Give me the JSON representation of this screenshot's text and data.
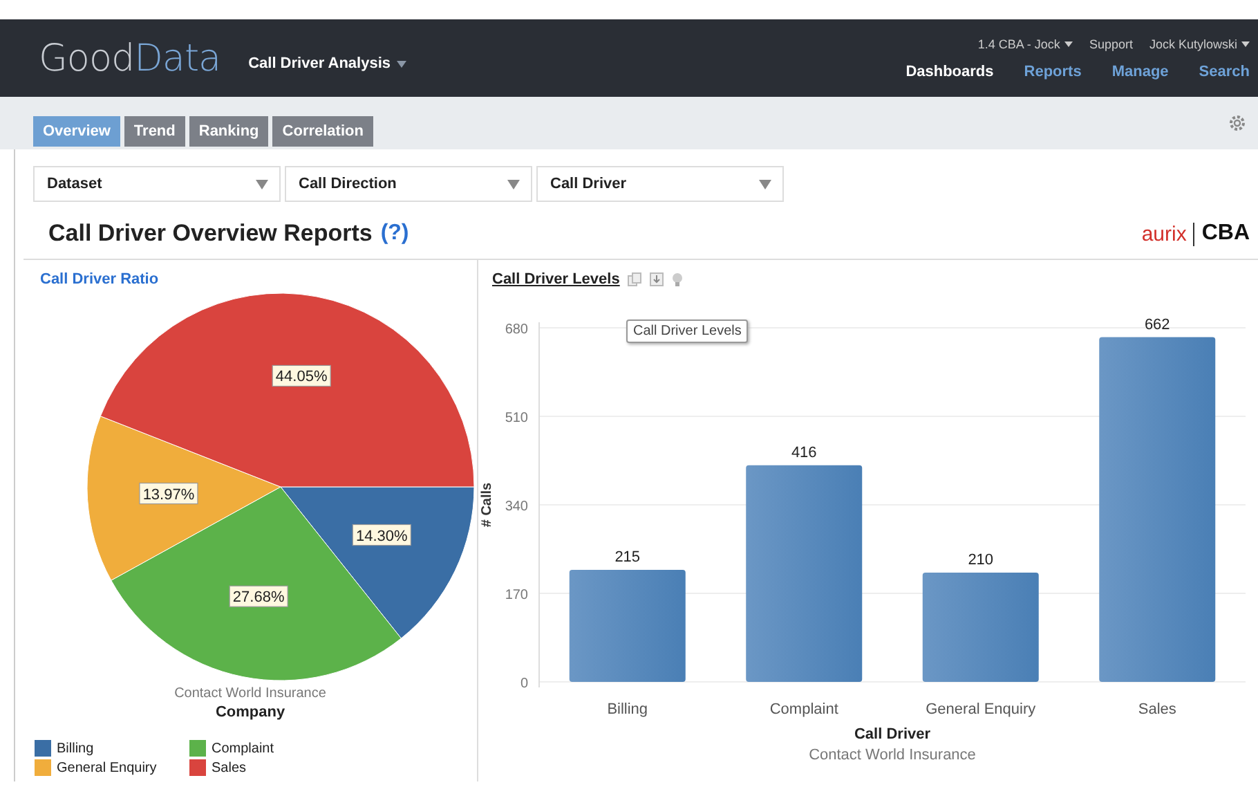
{
  "header": {
    "logo_parts": [
      "Good",
      "Data"
    ],
    "project": "Call Driver Analysis",
    "top_links": [
      {
        "label": "1.4 CBA - Jock",
        "dropdown": true
      },
      {
        "label": "Support",
        "dropdown": false
      },
      {
        "label": "Jock Kutylowski",
        "dropdown": true
      }
    ],
    "nav": [
      {
        "label": "Dashboards",
        "selected": true
      },
      {
        "label": "Reports",
        "selected": false
      },
      {
        "label": "Manage",
        "selected": false
      },
      {
        "label": "Search",
        "selected": false
      }
    ]
  },
  "tabs": [
    {
      "label": "Overview",
      "selected": true
    },
    {
      "label": "Trend",
      "selected": false
    },
    {
      "label": "Ranking",
      "selected": false
    },
    {
      "label": "Correlation",
      "selected": false
    }
  ],
  "filters": [
    {
      "label": "Dataset"
    },
    {
      "label": "Call Direction"
    },
    {
      "label": "Call Driver"
    }
  ],
  "page_title": "Call Driver Overview Reports",
  "help": "(?)",
  "brand": [
    "aurix",
    "CBA"
  ],
  "ratio_report": {
    "title": "Call Driver Ratio",
    "caption": "Contact World Insurance",
    "caption_bold": "Company",
    "chart_data": {
      "type": "pie",
      "categories": [
        "Billing",
        "Complaint",
        "General Enquiry",
        "Sales"
      ],
      "series": [
        {
          "values": [
            14.3,
            27.68,
            13.97,
            44.05
          ]
        }
      ],
      "colors": [
        "#3a6ea5",
        "#5cb24a",
        "#f0ad3c",
        "#d9443e"
      ],
      "value_labels": [
        "14.30%",
        "27.68%",
        "13.97%",
        "44.05%"
      ]
    }
  },
  "levels_report": {
    "title": "Call Driver Levels",
    "tooltip": "Call Driver Levels",
    "subtitle": "Contact World Insurance",
    "chart_data": {
      "type": "bar",
      "xlabel": "Call Driver",
      "ylabel": "# Calls",
      "categories": [
        "Billing",
        "Complaint",
        "General Enquiry",
        "Sales"
      ],
      "series": [
        {
          "color": "#4a7fb5",
          "values": [
            215,
            416,
            210,
            662
          ]
        }
      ],
      "ylim": [
        0,
        680
      ],
      "yticks": [
        0,
        170,
        340,
        510,
        680
      ],
      "grid": true,
      "data_labels": true
    }
  }
}
